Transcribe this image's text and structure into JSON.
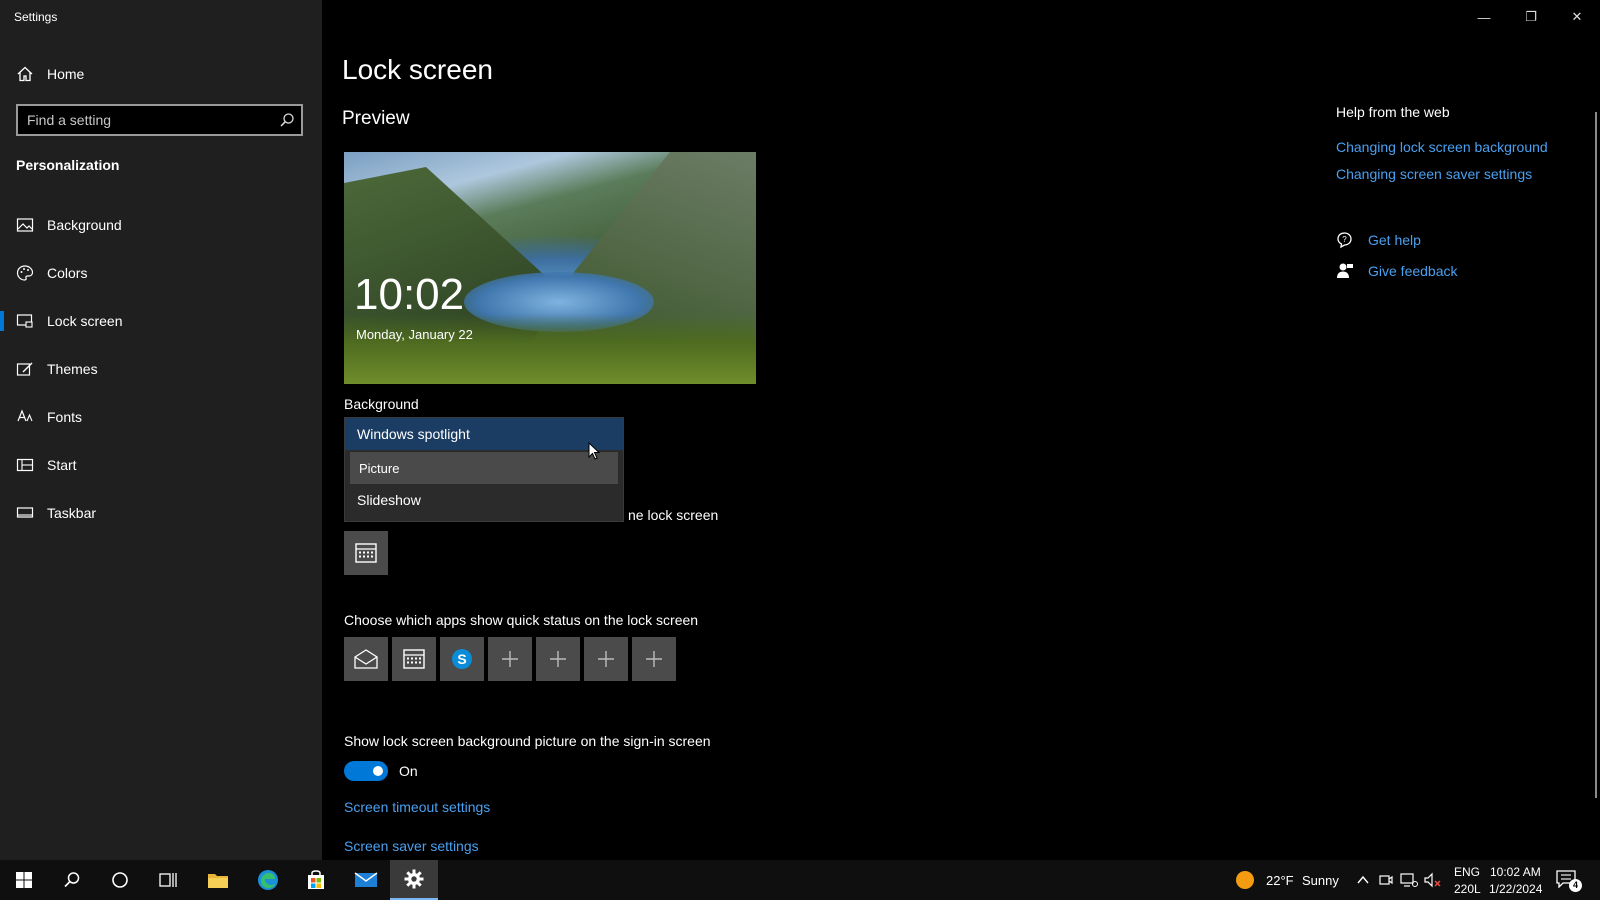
{
  "window": {
    "title": "Settings",
    "controls": {
      "minimize": "—",
      "restore": "❐",
      "close": "✕"
    }
  },
  "sidebar": {
    "home_label": "Home",
    "search": {
      "placeholder": "Find a setting"
    },
    "section_title": "Personalization",
    "items": [
      {
        "label": "Background",
        "icon": "picture-icon"
      },
      {
        "label": "Colors",
        "icon": "palette-icon"
      },
      {
        "label": "Lock screen",
        "icon": "lock-screen-icon",
        "active": true
      },
      {
        "label": "Themes",
        "icon": "themes-icon"
      },
      {
        "label": "Fonts",
        "icon": "fonts-icon"
      },
      {
        "label": "Start",
        "icon": "start-icon"
      },
      {
        "label": "Taskbar",
        "icon": "taskbar-icon"
      }
    ]
  },
  "main": {
    "title": "Lock screen",
    "preview": {
      "heading": "Preview",
      "time": "10:02",
      "date": "Monday, January 22"
    },
    "background": {
      "label": "Background",
      "options": [
        "Windows spotlight",
        "Picture",
        "Slideshow"
      ],
      "selected": "Windows spotlight",
      "hovered": "Picture"
    },
    "detailed_status_label_tail": "ne lock screen",
    "quick_status_label": "Choose which apps show quick status on the lock screen",
    "signin": {
      "label": "Show lock screen background picture on the sign-in screen",
      "state": "On",
      "enabled": true
    },
    "links": {
      "screen_timeout": "Screen timeout settings",
      "screen_saver": "Screen saver settings"
    }
  },
  "help": {
    "title": "Help from the web",
    "links": [
      "Changing lock screen background",
      "Changing screen saver settings"
    ],
    "get_help": "Get help",
    "give_feedback": "Give feedback"
  },
  "taskbar": {
    "weather": {
      "temp": "22°F",
      "condition": "Sunny"
    },
    "language": {
      "line1": "ENG",
      "line2": "220L"
    },
    "clock": {
      "time": "10:02 AM",
      "date": "1/22/2024"
    },
    "notifications_count": "4"
  },
  "colors": {
    "accent": "#0078d7",
    "link": "#4aa0f0",
    "sidebar_bg": "#1f1f1f",
    "dropdown_selected": "#1c3d63"
  }
}
